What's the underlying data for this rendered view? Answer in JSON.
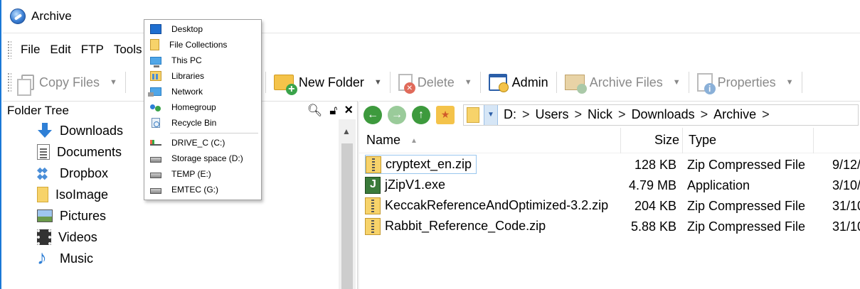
{
  "window": {
    "title": "Archive"
  },
  "menubar": {
    "items": [
      "File",
      "Edit",
      "FTP",
      "Tools"
    ]
  },
  "toolbar": {
    "copy_files": "Copy Files",
    "rename_partial": "ame",
    "new_folder": "New Folder",
    "delete": "Delete",
    "admin": "Admin",
    "archive_files": "Archive Files",
    "properties": "Properties"
  },
  "folder_tree": {
    "header": "Folder Tree",
    "items": [
      "Downloads",
      "Documents",
      "Dropbox",
      "IsoImage",
      "Pictures",
      "Videos",
      "Music"
    ]
  },
  "address": {
    "crumbs": [
      "D:",
      "Users",
      "Nick",
      "Downloads",
      "Archive"
    ],
    "separator": ">"
  },
  "file_list": {
    "columns": {
      "name": "Name",
      "size": "Size",
      "type": "Type"
    },
    "rows": [
      {
        "name": "cryptext_en.zip",
        "size": "128 KB",
        "type": "Zip Compressed File",
        "date": "9/12/",
        "icon": "zip-icon"
      },
      {
        "name": "jZipV1.exe",
        "size": "4.79 MB",
        "type": "Application",
        "date": "3/10/",
        "icon": "exe-icon"
      },
      {
        "name": "KeccakReferenceAndOptimized-3.2.zip",
        "size": "204 KB",
        "type": "Zip Compressed File",
        "date": "31/10/",
        "icon": "zip-icon"
      },
      {
        "name": "Rabbit_Reference_Code.zip",
        "size": "5.88 KB",
        "type": "Zip Compressed File",
        "date": "31/10/",
        "icon": "zip-icon"
      }
    ]
  },
  "dropdown": {
    "items": [
      "Desktop",
      "File Collections",
      "This PC",
      "Libraries",
      "Network",
      "Homegroup",
      "Recycle Bin"
    ],
    "drives": [
      "DRIVE_C (C:)",
      "Storage space (D:)",
      "TEMP (E:)",
      "EMTEC (G:)"
    ]
  },
  "colors": {
    "accent": "#1a78d6",
    "folder": "#f7d36a",
    "nav_green": "#3d9a3d"
  }
}
